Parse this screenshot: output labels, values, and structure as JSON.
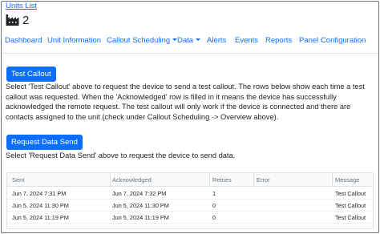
{
  "header": {
    "back_link": "Units List",
    "icon": "factory-icon",
    "unit_name": "2"
  },
  "nav": [
    {
      "label": "Dashboard",
      "dropdown": false
    },
    {
      "label": "Unit Information",
      "dropdown": false
    },
    {
      "label": "Callout Scheduling",
      "dropdown": true
    },
    {
      "label": "Data",
      "dropdown": true
    },
    {
      "label": "Alerts",
      "dropdown": false
    },
    {
      "label": "Events",
      "dropdown": false
    },
    {
      "label": "Reports",
      "dropdown": false
    },
    {
      "label": "Panel Configuration",
      "dropdown": false
    }
  ],
  "test_callout": {
    "button_label": "Test Callout",
    "description": "Select 'Test Callout' above to request the device to send a test callout. The rows below show each time a test callout was requested. When the 'Acknowledged' row is filled in it means the device has successfully acknowledged the remote request. The test callout will only work if the device is connected and there are contacts assigned to the unit (check under Callout Scheduling -> Overview above)."
  },
  "request_data": {
    "button_label": "Request Data Send",
    "description": "Select 'Request Data Send' above to request the device to send data."
  },
  "table": {
    "columns": [
      "Sent",
      "Acknowledged",
      "Retries",
      "Error",
      "Message"
    ],
    "rows": [
      [
        "Jun 7, 2024 7:31 PM",
        "Jun 7, 2024 7:32 PM",
        "1",
        "",
        "Test Callout"
      ],
      [
        "Jun 5, 2024 11:30 PM",
        "Jun 5, 2024 11:30 PM",
        "0",
        "",
        "Test Callout"
      ],
      [
        "Jun 5, 2024 11:19 PM",
        "Jun 5, 2024 11:19 PM",
        "0",
        "",
        "Test Callout"
      ]
    ]
  },
  "colors": {
    "primary": "#0d6efd",
    "text": "#212529",
    "muted": "#6c757d",
    "border": "#dee2e6"
  }
}
